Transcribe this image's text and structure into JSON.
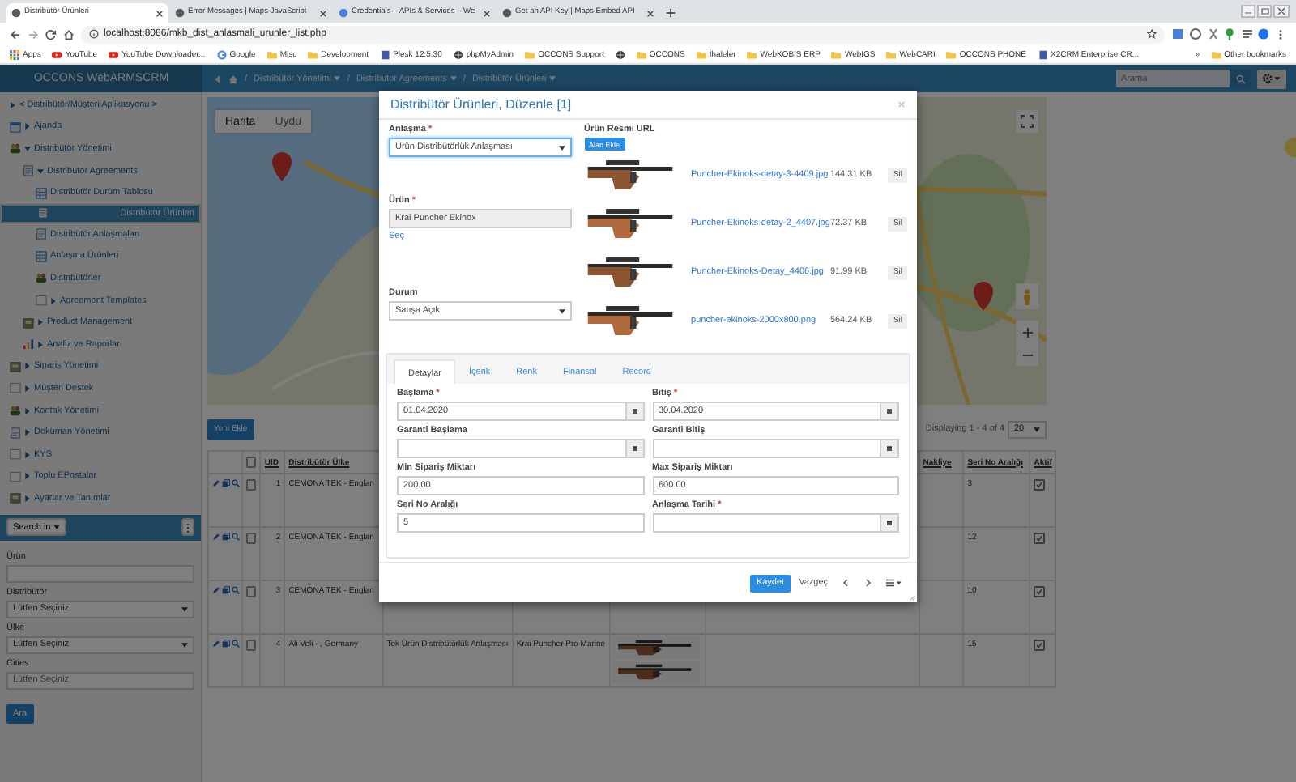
{
  "browser": {
    "tabs": [
      {
        "title": "Distribütör Ürünleri",
        "selected": true
      },
      {
        "title": "Error Messages | Maps JavaScript",
        "selected": false
      },
      {
        "title": "Credentials – APIs & Services – We",
        "selected": false
      },
      {
        "title": "Get an API Key | Maps Embed API",
        "selected": false
      }
    ],
    "url": "localhost:8086/mkb_dist_anlasmali_urunler_list.php",
    "bookmarks": [
      {
        "label": "Apps",
        "kind": "apps"
      },
      {
        "label": "YouTube",
        "kind": "youtube"
      },
      {
        "label": "YouTube Downloader...",
        "kind": "youtube"
      },
      {
        "label": "Google",
        "kind": "google"
      },
      {
        "label": "Misc",
        "kind": "folder"
      },
      {
        "label": "Development",
        "kind": "folder"
      },
      {
        "label": "Plesk 12.5.30",
        "kind": "page"
      },
      {
        "label": "phpMyAdmin",
        "kind": "globe"
      },
      {
        "label": "OCCONS Support",
        "kind": "folder"
      },
      {
        "kind": "globe"
      },
      {
        "label": "OCCONS",
        "kind": "folder"
      },
      {
        "label": "İhaleler",
        "kind": "folder"
      },
      {
        "label": "WebKOBIS ERP",
        "kind": "folder"
      },
      {
        "label": "WebIGS",
        "kind": "folder"
      },
      {
        "label": "WebCARI",
        "kind": "folder"
      },
      {
        "label": "OCCONS PHONE",
        "kind": "folder"
      },
      {
        "label": "X2CRM Enterprise CR...",
        "kind": "page"
      }
    ],
    "more": "»",
    "other": "Other bookmarks"
  },
  "header": {
    "brand": "OCCONS WebARMSCRM",
    "breadcrumbs": [
      {
        "separator": "/",
        "label": "Distribütör Yönetimi"
      },
      {
        "separator": "/",
        "label": "Distributor Agreements"
      },
      {
        "separator": "/",
        "label": "Distribütör Ürünleri"
      }
    ],
    "search": {
      "placeholder": "Arama"
    }
  },
  "sidebar": {
    "items": [
      {
        "label": "< Distribütör/Müşteri Aplikasyonu >",
        "kind": "none",
        "expanded": false,
        "selected": false
      },
      {
        "label": "Ajanda",
        "kind": "calendar",
        "expanded": false,
        "selected": false
      },
      {
        "label": "Distribütör Yönetimi",
        "kind": "people",
        "expanded": true,
        "selected": false,
        "children": [
          {
            "label": "Distributor Agreements",
            "kind": "doc",
            "expanded": true,
            "selected": false,
            "children": [
              {
                "label": "Distribütör Durum Tablosu",
                "kind": "table",
                "selected": false
              },
              {
                "label": "Distribütör Ürünleri",
                "kind": "doc",
                "selected": true
              },
              {
                "label": "Distribütör Anlaşmaları",
                "kind": "doc",
                "selected": false
              },
              {
                "label": "Anlaşma Ürünleri",
                "kind": "table",
                "selected": false
              },
              {
                "label": "Distribütörler",
                "kind": "people",
                "selected": false
              },
              {
                "label": "Agreement Templates",
                "kind": "blank",
                "expanded": false,
                "selected": false
              }
            ]
          },
          {
            "label": "Product Management",
            "kind": "box",
            "expanded": false,
            "selected": false
          },
          {
            "label": "Analiz ve Raporlar",
            "kind": "chart",
            "expanded": false,
            "selected": false
          }
        ]
      },
      {
        "label": "Sipariş Yönetimi",
        "kind": "box",
        "expanded": false,
        "selected": false
      },
      {
        "label": "Müşteri Destek",
        "kind": "blank",
        "expanded": false,
        "selected": false
      },
      {
        "label": "Kontak Yönetimi",
        "kind": "people",
        "expanded": false,
        "selected": false
      },
      {
        "label": "Doküman Yönetimi",
        "kind": "doc",
        "expanded": false,
        "selected": false
      },
      {
        "label": "KYS",
        "kind": "blank",
        "expanded": false,
        "selected": false
      },
      {
        "label": "Toplu EPostalar",
        "kind": "blank",
        "expanded": false,
        "selected": false
      },
      {
        "label": "Ayarlar ve Tanımlar",
        "kind": "box",
        "expanded": false,
        "selected": false
      }
    ],
    "search_in": "Search in",
    "menu_button": "⋮",
    "filters": [
      {
        "label": "Ürün",
        "kind": "input"
      },
      {
        "label": "Distribütör",
        "kind": "select",
        "value": "Lütfen Seçiniz"
      },
      {
        "label": "Ülke",
        "kind": "select",
        "value": "Lütfen Seçiniz"
      },
      {
        "label": "Cities",
        "kind": "input",
        "placeholder": "Lütfen Seçiniz"
      }
    ],
    "search_button": "Ara"
  },
  "map": {
    "tabs": [
      {
        "label": "Harita",
        "selected": true
      },
      {
        "label": "Uydu",
        "selected": false
      }
    ]
  },
  "list": {
    "add_button": "Yeni Ekle",
    "paging": "Displaying 1 - 4 of 4",
    "page_size": "20"
  },
  "table": {
    "select_all": false,
    "header": {
      "uid": "UID",
      "country": "Distribütör Ülke",
      "shipping": "Nakliye",
      "serial": "Seri No Aralığı",
      "active": "Aktif"
    },
    "rows": [
      {
        "uid": "1",
        "country": "CEMONA TEK - Englan",
        "serial": "3",
        "active": true,
        "selected": false
      },
      {
        "uid": "2",
        "country": "CEMONA TEK - Englan",
        "serial": "12",
        "active": true,
        "selected": false
      },
      {
        "uid": "3",
        "country": "CEMONA TEK - Englan",
        "serial": "10",
        "active": true,
        "selected": false
      },
      {
        "uid": "4",
        "country": "Ali Veli - , Germany",
        "agreement": "Tek Ürün Distribütörlük Anlaşması",
        "product": "Krai Puncher Pro Marine",
        "serial": "15",
        "active": true,
        "selected": false
      }
    ]
  },
  "modal": {
    "title": "Distribütör Ürünleri, Düzenle [1]",
    "agreement": {
      "label": "Anlaşma",
      "mark": "*",
      "value": "Ürün Distribütörlük Anlaşması"
    },
    "product": {
      "label": "Ürün",
      "mark": "*",
      "value": "Krai Puncher Ekinox",
      "link": "Seç"
    },
    "status": {
      "label": "Durum",
      "value": "Satışa Açık"
    },
    "images": {
      "label": "Ürün Resmi URL",
      "add_button": "Alan Ekle",
      "files": [
        {
          "name": "Puncher-Ekinoks-detay-3-4409.jpg",
          "size": "144.31 KB",
          "delete": "Sil"
        },
        {
          "name": "Puncher-Ekinoks-detay-2_4407.jpg",
          "size": "72.37 KB",
          "delete": "Sil"
        },
        {
          "name": "Puncher-Ekinoks-Detay_4406.jpg",
          "size": "91.99 KB",
          "delete": "Sil"
        },
        {
          "name": "puncher-ekinoks-2000x800.png",
          "size": "564.24 KB",
          "delete": "Sil"
        }
      ]
    },
    "tabs": [
      {
        "label": "Detaylar",
        "selected": true
      },
      {
        "label": "İçerik",
        "selected": false
      },
      {
        "label": "Renk",
        "selected": false
      },
      {
        "label": "Finansal",
        "selected": false
      },
      {
        "label": "Record",
        "selected": false
      }
    ],
    "fields": [
      {
        "label": "Başlama",
        "mark": "*",
        "value": "01.04.2020",
        "kind": "date"
      },
      {
        "label": "Bitiş",
        "mark": "*",
        "value": "30.04.2020",
        "kind": "date"
      },
      {
        "label": "Garanti Başlama",
        "kind": "date"
      },
      {
        "label": "Garanti Bitiş",
        "kind": "date"
      },
      {
        "label": "Min Sipariş Miktarı",
        "value": "200.00",
        "kind": "text"
      },
      {
        "label": "Max Sipariş Miktarı",
        "value": "600.00",
        "kind": "text"
      },
      {
        "label": "Seri No Aralığı",
        "value": "5",
        "kind": "text"
      },
      {
        "label": "Anlaşma Tarihi",
        "mark": "*",
        "kind": "date"
      }
    ],
    "save": "Kaydet",
    "cancel": "Vazgeç"
  }
}
